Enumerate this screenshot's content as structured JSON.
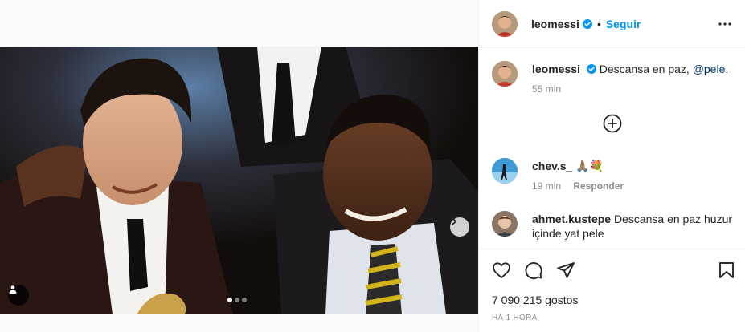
{
  "header": {
    "username": "leomessi",
    "separator": "•",
    "follow_label": "Seguir",
    "verified_icon": "verified-badge-icon",
    "more_icon": "more-options-icon"
  },
  "caption": {
    "username": "leomessi",
    "text": "Descansa en paz, ",
    "mention": "@pele",
    "trailing": ".",
    "time": "55 min"
  },
  "comments": [
    {
      "username": "chev.s_",
      "text": "🙏🏽💐",
      "time": "19 min",
      "reply_label": "Responder"
    },
    {
      "username": "ahmet.kustepe",
      "text": "Descansa en paz huzur içinde yat pele"
    }
  ],
  "actions": {
    "like_icon": "heart-icon",
    "comment_icon": "comment-icon",
    "share_icon": "share-icon",
    "save_icon": "bookmark-icon",
    "likes_text": "7 090 215 gostos",
    "posted_time": "HÁ 1 HORA"
  },
  "carousel": {
    "slides": 3,
    "active_slide": 1,
    "next_icon": "chevron-right-icon",
    "tag_icon": "user-tag-icon"
  },
  "colors": {
    "accent": "#0095f6",
    "verified": "#0095f6",
    "mention": "#00376b",
    "muted": "#8e8e8e"
  }
}
